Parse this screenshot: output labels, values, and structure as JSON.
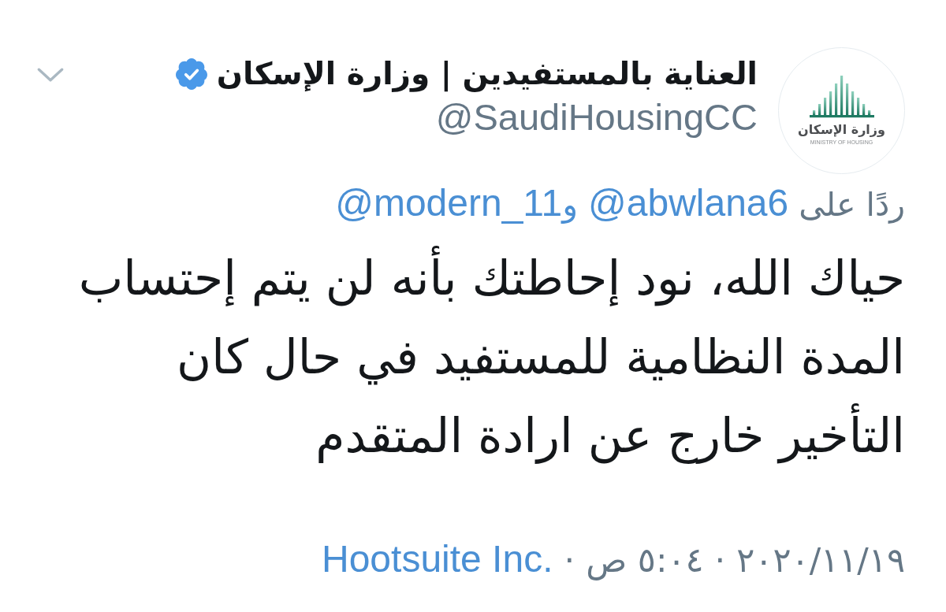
{
  "account": {
    "name": "العناية بالمستفيدين | وزارة الإسكان",
    "verified": true,
    "handle": "@SaudiHousingCC",
    "logo": {
      "title": "وزارة الإسكان",
      "subtitle": "MINISTRY OF HOUSING"
    }
  },
  "reply_to": {
    "label": "ردًا على",
    "handles": [
      "@abwlana6",
      "@modern_11"
    ],
    "joiner": "و"
  },
  "body": "حياك الله، نود إحاطتك بأنه لن يتم إحتساب\nالمدة النظامية للمستفيد في حال كان\nالتأخير خارج عن ارادة المتقدم",
  "footer": [
    {
      "kind": "text",
      "text": "٢٠٢٠/١١/١٩"
    },
    {
      "kind": "separator",
      "text": "·"
    },
    {
      "kind": "text",
      "text": "٥:٠٤ ص"
    },
    {
      "kind": "separator",
      "text": "·"
    },
    {
      "kind": "link",
      "text": "Hootsuite Inc."
    }
  ]
}
